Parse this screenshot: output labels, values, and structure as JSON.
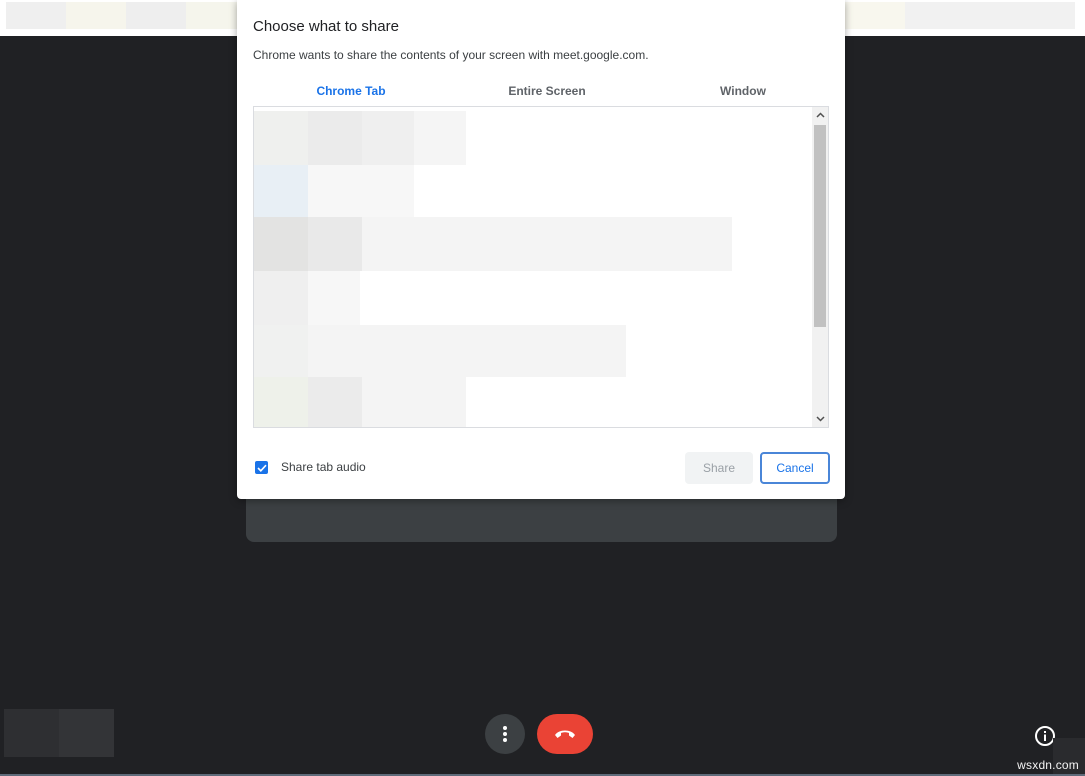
{
  "dialog": {
    "title": "Choose what to share",
    "subtitle": "Chrome wants to share the contents of your screen with meet.google.com.",
    "tabs": [
      {
        "label": "Chrome Tab",
        "active": true
      },
      {
        "label": "Entire Screen",
        "active": false
      },
      {
        "label": "Window",
        "active": false
      }
    ],
    "share_audio": {
      "label": "Share tab audio",
      "checked": true
    },
    "buttons": {
      "share": "Share",
      "cancel": "Cancel"
    }
  },
  "meeting_controls": {
    "more_icon": "more-vert-icon",
    "hangup_icon": "call-end-icon",
    "info_icon": "info-icon"
  },
  "watermark": "wsxdn.com",
  "colors": {
    "accent": "#1a73e8",
    "background": "#202124",
    "hangup": "#ea4335"
  }
}
